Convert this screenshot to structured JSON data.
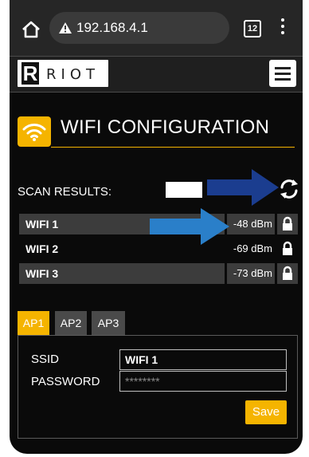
{
  "browser": {
    "url": "192.168.4.1",
    "tab_count": "12",
    "icons": [
      "home-icon",
      "warning-icon",
      "kebab-menu-icon"
    ]
  },
  "header": {
    "logo_letter": "R",
    "logo_text": "RIOT",
    "menu_icon": "hamburger-icon"
  },
  "section": {
    "title": "WIFI CONFIGURATION",
    "icon": "wifi-icon",
    "accent_color": "#f5b400"
  },
  "scan": {
    "label": "SCAN RESULTS:",
    "refresh_icon": "refresh-icon",
    "networks": [
      {
        "ssid": "WIFI 1",
        "signal": "-48 dBm",
        "lock_icon": "lock-icon"
      },
      {
        "ssid": "WIFI 2",
        "signal": "-69 dBm",
        "lock_icon": "lock-icon"
      },
      {
        "ssid": "WIFI 3",
        "signal": "-73 dBm",
        "lock_icon": "lock-icon"
      }
    ]
  },
  "ap_tabs": [
    {
      "label": "AP1",
      "active": true
    },
    {
      "label": "AP2",
      "active": false
    },
    {
      "label": "AP3",
      "active": false
    }
  ],
  "form": {
    "ssid_label": "SSID",
    "ssid_value": "WIFI 1",
    "password_label": "PASSWORD",
    "password_placeholder": "********",
    "save_label": "Save"
  },
  "annotations": {
    "arrow_color": "#1b3d8f",
    "arrow_icon": "arrow-right-icon"
  }
}
